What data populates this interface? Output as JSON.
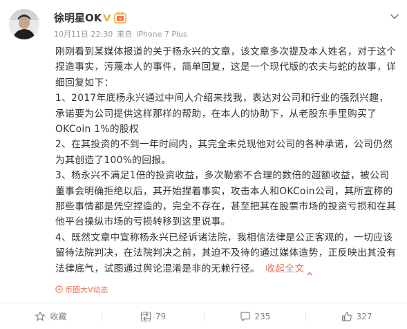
{
  "post": {
    "author": "徐明星OK",
    "date": "10月11日 22:30",
    "source_prefix": "来自",
    "device": "iPhone 7 Plus",
    "paragraphs": [
      "刚刚看到某媒体报道的关于杨永兴的文章，该文章多次提及本人姓名，对于这个捏造事实，污蔑本人的事件，简单回复，这是一个现代版的农夫与蛇的故事，详细回复如下：",
      "1、2017年底杨永兴通过中间人介绍来找我，表达对公司和行业的强烈兴趣，承诺要为公司提供这样那样的帮助，在本人的协助下，从老股东手里购买了OKCoin 1%的股权",
      "2、在其投资的不到一年时间内，其完全未兑现他对公司的各种承诺，公司仍然为其创造了100%的回报。",
      "3、杨永兴不满足1倍的投资收益，多次勒索不合理的数倍的超额收益，被公司董事会明确拒绝以后，其开始捏着事实，攻击本人和OKCoin公司，其所宣称的那些事情都是凭空捏造的，完全不存在，甚至把其在股票市场的投资亏损和在其他平台操纵市场的亏损转移到这里说事。",
      "4、既然文章中宣称杨永兴已经诉诸法院，我相信法律是公正客观的，一切应该留待法院判决，在法院判决之前，其迫不及待的通过媒体造势，正反映出其没有法律底气，试图通过舆论混淆是非的无赖行径。"
    ],
    "collapse_label": "收起全文",
    "source_tag": "币圈大V动态"
  },
  "actions": {
    "favorite_label": "收藏",
    "repost_count": "79",
    "comment_count": "235",
    "like_count": "327"
  },
  "colors": {
    "accent": "#eb7350",
    "verified": "#f6a623",
    "text": "#333333",
    "meta": "#999999"
  },
  "icons": [
    "verified-badge-icon",
    "member-badge-icon",
    "chevron-down-icon",
    "link-icon",
    "star-icon",
    "repost-icon",
    "comment-icon",
    "like-icon"
  ]
}
